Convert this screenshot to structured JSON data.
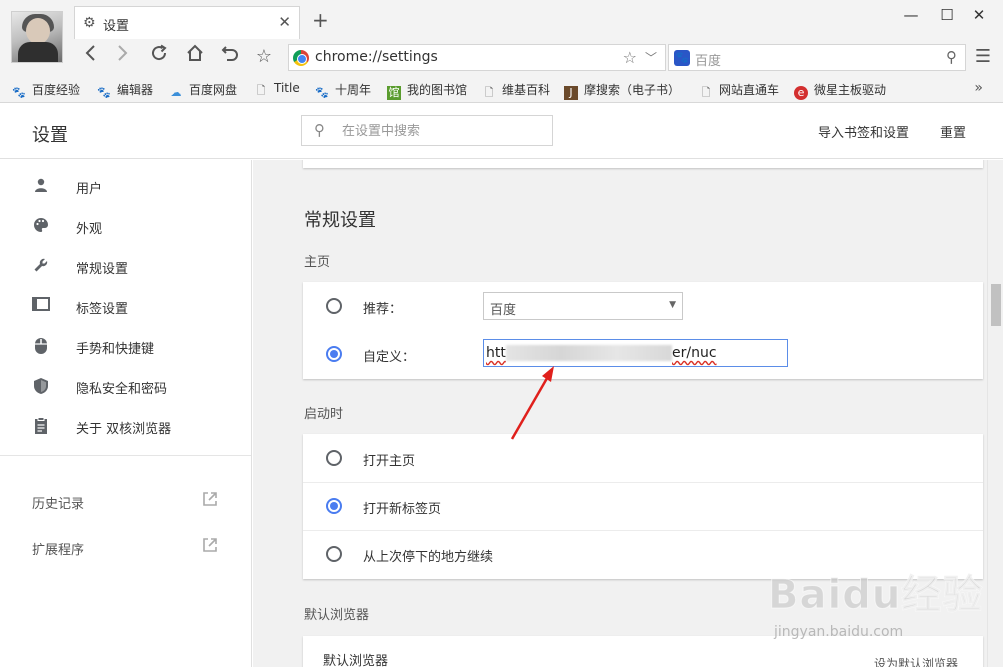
{
  "browser": {
    "tab_title": "设置",
    "tab_icon": "gear-icon",
    "new_tab_symbol": "+",
    "address": "chrome://settings",
    "search_engine_placeholder": "百度",
    "window_controls": [
      "minimize",
      "maximize",
      "close"
    ]
  },
  "bookmarks": [
    {
      "label": "百度经验",
      "icon": "baidu-paw-icon"
    },
    {
      "label": "编辑器",
      "icon": "baidu-paw-icon"
    },
    {
      "label": "百度网盘",
      "icon": "cloud-icon"
    },
    {
      "label": "Title",
      "icon": "page-icon"
    },
    {
      "label": "十周年",
      "icon": "baidu-paw-icon"
    },
    {
      "label": "我的图书馆",
      "icon": "library-icon"
    },
    {
      "label": "维基百科",
      "icon": "page-icon"
    },
    {
      "label": "摩搜索（电子书）",
      "icon": "j-icon"
    },
    {
      "label": "网站直通车",
      "icon": "page-icon"
    },
    {
      "label": "微星主板驱动",
      "icon": "msi-icon"
    }
  ],
  "header": {
    "title": "设置",
    "search_placeholder": "在设置中搜索",
    "import_label": "导入书签和设置",
    "reset_label": "重置"
  },
  "sidebar": {
    "items": [
      {
        "label": "用户",
        "icon": "person-icon"
      },
      {
        "label": "外观",
        "icon": "palette-icon"
      },
      {
        "label": "常规设置",
        "icon": "wrench-icon"
      },
      {
        "label": "标签设置",
        "icon": "tab-icon"
      },
      {
        "label": "手势和快捷键",
        "icon": "mouse-icon"
      },
      {
        "label": "隐私安全和密码",
        "icon": "shield-icon"
      },
      {
        "label": "关于 双核浏览器",
        "icon": "clipboard-icon"
      }
    ],
    "links": [
      {
        "label": "历史记录",
        "icon": "external-link-icon"
      },
      {
        "label": "扩展程序",
        "icon": "external-link-icon"
      }
    ]
  },
  "main": {
    "section_title": "常规设置",
    "homepage": {
      "label": "主页",
      "recommend_label": "推荐：",
      "recommend_value": "百度",
      "custom_label": "自定义：",
      "custom_value_start": "htt",
      "custom_value_end": "er/nuc",
      "selected": "custom"
    },
    "startup": {
      "label": "启动时",
      "options": [
        "打开主页",
        "打开新标签页",
        "从上次停下的地方继续"
      ],
      "selected_index": 1
    },
    "default_browser": {
      "label": "默认浏览器",
      "row_label": "默认浏览器",
      "button_label": "设为默认浏览器"
    }
  },
  "watermark": {
    "logo_text": "Baidu经验",
    "url": "jingyan.baidu.com"
  },
  "colors": {
    "accent": "#4a7cf0",
    "arrow": "#e0201c"
  }
}
